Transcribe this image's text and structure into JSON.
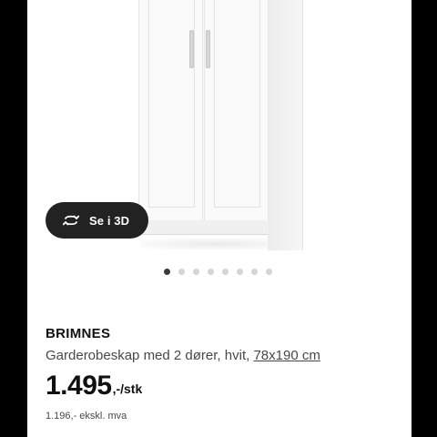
{
  "product": {
    "brand": "BRIMNES",
    "description": "Garderobeskap med 2 dører, hvit,",
    "dimensions": "78x190 cm",
    "price_main": "1.495",
    "price_suffix": ",-/stk",
    "price_ex_vat": "1.196,- ekskl. mva"
  },
  "viewer": {
    "button_3d_label": "Se i 3D",
    "button_icon": "rotate-3d-icon",
    "image_count": 8,
    "active_image": 1
  },
  "colors": {
    "button_bg": "#222222",
    "active_dot": "#3a3a3a",
    "inactive_dot": "#d4d4d4"
  }
}
